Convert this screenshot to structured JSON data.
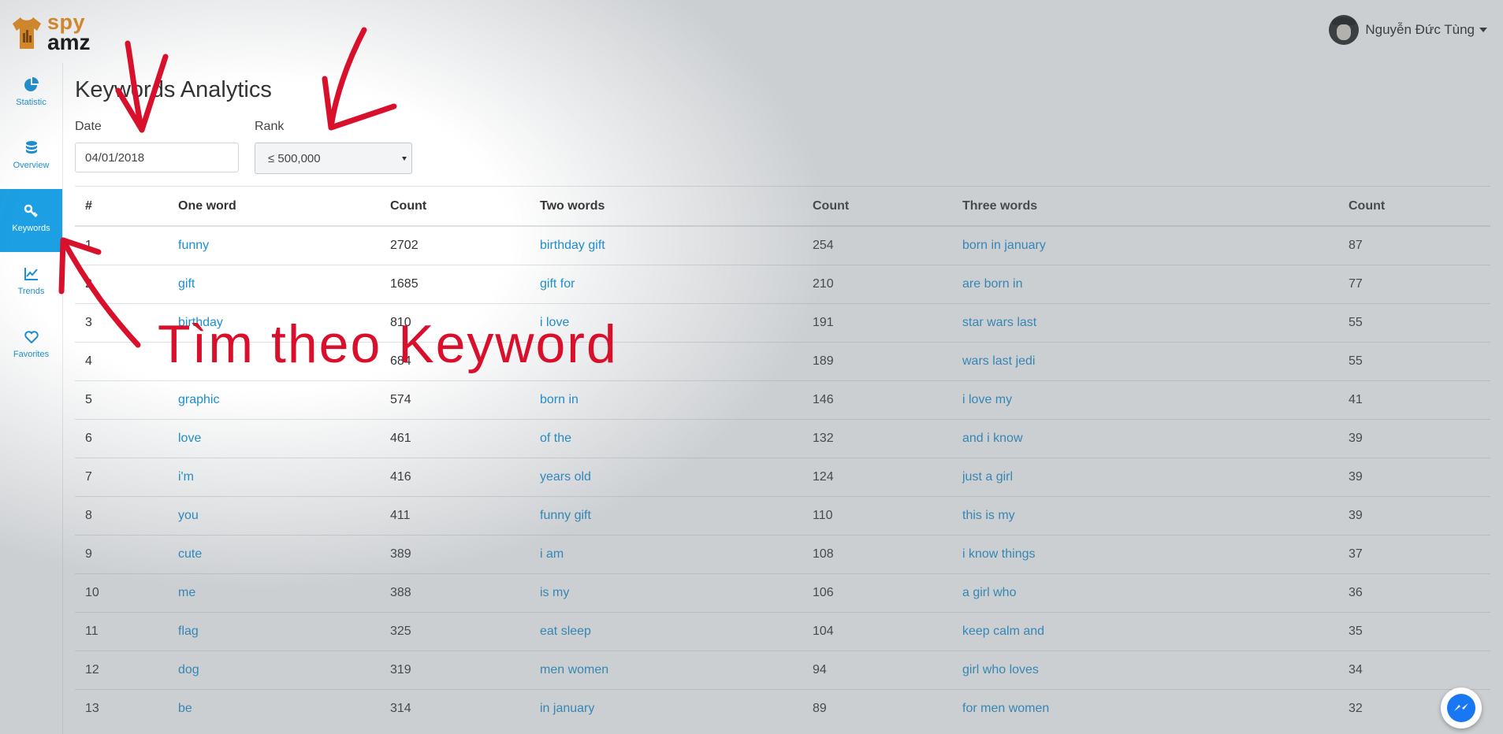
{
  "app": {
    "logo_top": "spy",
    "logo_bottom": "amz"
  },
  "user": {
    "name": "Nguyễn Đức Tùng"
  },
  "sidebar": {
    "items": [
      {
        "label": "Statistic",
        "icon": "pie-chart-icon",
        "active": false
      },
      {
        "label": "Overview",
        "icon": "database-icon",
        "active": false
      },
      {
        "label": "Keywords",
        "icon": "key-icon",
        "active": true
      },
      {
        "label": "Trends",
        "icon": "line-chart-icon",
        "active": false
      },
      {
        "label": "Favorites",
        "icon": "heart-icon",
        "active": false
      }
    ]
  },
  "page": {
    "title": "Keywords Analytics"
  },
  "filters": {
    "date_label": "Date",
    "date_value": "04/01/2018",
    "rank_label": "Rank",
    "rank_value": "≤ 500,000"
  },
  "table": {
    "headers": [
      "#",
      "One word",
      "Count",
      "Two words",
      "Count",
      "Three words",
      "Count"
    ],
    "rows": [
      [
        "1",
        "funny",
        "2702",
        "birthday gift",
        "254",
        "born in january",
        "87"
      ],
      [
        "2",
        "gift",
        "1685",
        "gift for",
        "210",
        "are born in",
        "77"
      ],
      [
        "3",
        "birthday",
        "810",
        "i love",
        "191",
        "star wars last",
        "55"
      ],
      [
        "4",
        "",
        "684",
        "",
        "189",
        "wars last jedi",
        "55"
      ],
      [
        "5",
        "graphic",
        "574",
        "born in",
        "146",
        "i love my",
        "41"
      ],
      [
        "6",
        "love",
        "461",
        "of the",
        "132",
        "and i know",
        "39"
      ],
      [
        "7",
        "i'm",
        "416",
        "years old",
        "124",
        "just a girl",
        "39"
      ],
      [
        "8",
        "you",
        "411",
        "funny gift",
        "110",
        "this is my",
        "39"
      ],
      [
        "9",
        "cute",
        "389",
        "i am",
        "108",
        "i know things",
        "37"
      ],
      [
        "10",
        "me",
        "388",
        "is my",
        "106",
        "a girl who",
        "36"
      ],
      [
        "11",
        "flag",
        "325",
        "eat sleep",
        "104",
        "keep calm and",
        "35"
      ],
      [
        "12",
        "dog",
        "319",
        "men women",
        "94",
        "girl who loves",
        "34"
      ],
      [
        "13",
        "be",
        "314",
        "in january",
        "89",
        "for men women",
        "32"
      ]
    ]
  },
  "annotation": {
    "text": "Tìm theo Keyword",
    "color": "#d8102b"
  },
  "colors": {
    "accent": "#1ca0e3",
    "link": "#1a8fd1",
    "brand": "#e48a1b"
  }
}
